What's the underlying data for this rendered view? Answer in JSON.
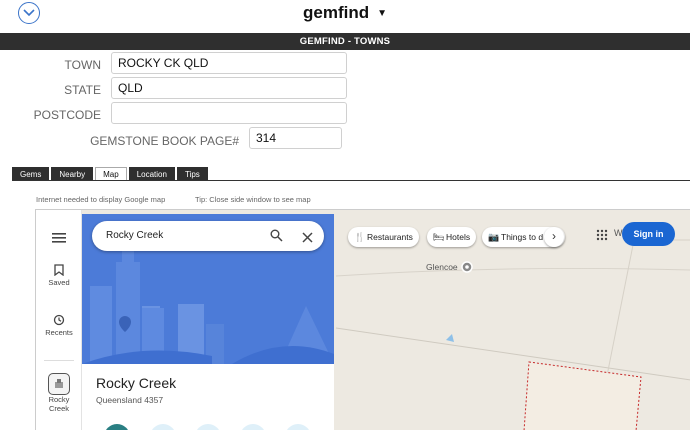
{
  "header": {
    "app_title": "gemfind",
    "banner": "GEMFIND - TOWNS"
  },
  "form": {
    "town_label": "TOWN",
    "town_value": "ROCKY CK QLD",
    "state_label": "STATE",
    "state_value": "QLD",
    "postcode_label": "POSTCODE",
    "postcode_value": "",
    "book_label": "GEMSTONE BOOK PAGE#",
    "book_value": "314"
  },
  "tabs": [
    {
      "label": "Gems",
      "active": false
    },
    {
      "label": "Nearby",
      "active": false
    },
    {
      "label": "Map",
      "active": true
    },
    {
      "label": "Location",
      "active": false
    },
    {
      "label": "Tips",
      "active": false
    }
  ],
  "hints": {
    "internet": "Internet needed to display Google map",
    "tip": "Tip: Close side window to see map"
  },
  "map": {
    "rail": {
      "saved": "Saved",
      "recents": "Recents",
      "place_line1": "Rocky",
      "place_line2": "Creek"
    },
    "search_value": "Rocky Creek",
    "place_title": "Rocky Creek",
    "place_subtitle": "Queensland 4357",
    "chips": {
      "restaurants": "Restaurants",
      "hotels": "Hotels",
      "things": "Things to d"
    },
    "glencoe": "Glencoe",
    "overflow_letter": "W",
    "sign_in": "Sign in"
  },
  "colors": {
    "accent": "#3b74c9",
    "banner_bg": "#2f2f2f",
    "hero_blue": "#4c7bd8",
    "sign_in_blue": "#1a66d2",
    "map_bg": "#ede9e1",
    "boundary_red": "#c62828"
  }
}
